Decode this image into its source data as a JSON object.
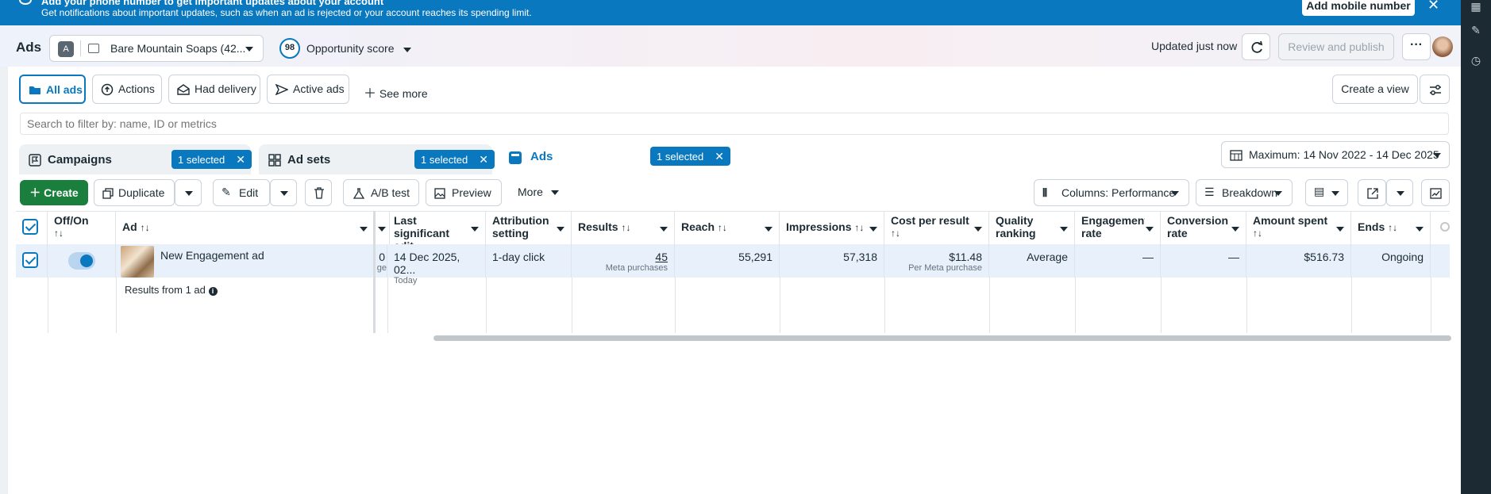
{
  "banner": {
    "title": "Add your phone number to get important updates about your account",
    "subtitle": "Get notifications about important updates, such as when an ad is rejected or your account reaches its spending limit.",
    "button": "Add mobile number"
  },
  "header": {
    "title": "Ads",
    "account_initial": "A",
    "account_name": "Bare Mountain Soaps (42...",
    "opportunity_value": "98",
    "opportunity_label": "Opportunity score",
    "updated": "Updated just now",
    "review_publish": "Review and publish",
    "more": "···"
  },
  "views": {
    "tabs": [
      "All ads",
      "Actions",
      "Had delivery",
      "Active ads"
    ],
    "see_more": "See more",
    "create_view": "Create a view"
  },
  "search": {
    "placeholder": "Search to filter by: name, ID or metrics"
  },
  "levels": {
    "campaigns": "Campaigns",
    "adsets": "Ad sets",
    "ads": "Ads",
    "selected": "1 selected",
    "date_range": "Maximum: 14 Nov 2022 - 14 Dec 2025"
  },
  "toolbar": {
    "create": "Create",
    "duplicate": "Duplicate",
    "edit": "Edit",
    "ab_test": "A/B test",
    "preview": "Preview",
    "more": "More",
    "columns": "Columns: Performance",
    "breakdown": "Breakdown"
  },
  "table": {
    "headers": {
      "offon": "Off/On",
      "ad": "Ad",
      "last_edit": "Last significant edit",
      "attribution": "Attribution setting",
      "results": "Results",
      "reach": "Reach",
      "impressions": "Impressions",
      "cost": "Cost per result",
      "quality": "Quality ranking",
      "engagement": "Engagement rate rankin...",
      "conversion": "Conversion rate rankin...",
      "amount": "Amount spent",
      "ends": "Ends"
    },
    "row": {
      "ad_name": "New Engagement ad",
      "hidden_value": "0",
      "hidden_sub": "ge",
      "last_edit": "14 Dec 2025, 02...",
      "last_edit_sub": "Today",
      "attribution": "1-day click",
      "results": "45",
      "results_sub": "Meta purchases",
      "reach": "55,291",
      "impressions": "57,318",
      "cost": "$11.48",
      "cost_sub": "Per Meta purchase",
      "quality": "Average",
      "engagement": "—",
      "conversion": "—",
      "amount": "$516.73",
      "ends": "Ongoing"
    },
    "summary": "Results from 1 ad"
  },
  "sort_glyph": "↑↓"
}
